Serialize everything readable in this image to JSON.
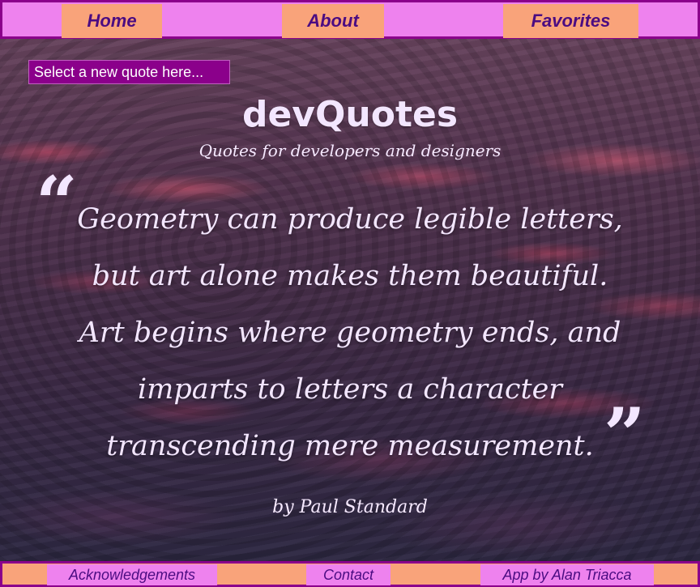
{
  "nav": {
    "home": "Home",
    "about": "About",
    "favorites": "Favorites"
  },
  "select_button": "Select a new quote here...",
  "site": {
    "title": "devQuotes",
    "subtitle": "Quotes for developers and designers"
  },
  "quote": {
    "open_mark": "“",
    "close_mark": "”",
    "text": "Geometry can produce legible letters, but art alone makes them beautiful. Art begins where geometry ends, and imparts to letters a character transcending mere measurement.",
    "author": "by Paul Standard"
  },
  "footer": {
    "acknowledgements": "Acknowledgements",
    "contact": "Contact",
    "app_by": "App by Alan Triacca"
  },
  "colors": {
    "nav_background": "#ee82ee",
    "nav_button": "#f9a37a",
    "nav_border": "#8b008b",
    "nav_text": "#4b0c82",
    "select_button": "#8b008b",
    "text_light": "#f3e6ff"
  }
}
